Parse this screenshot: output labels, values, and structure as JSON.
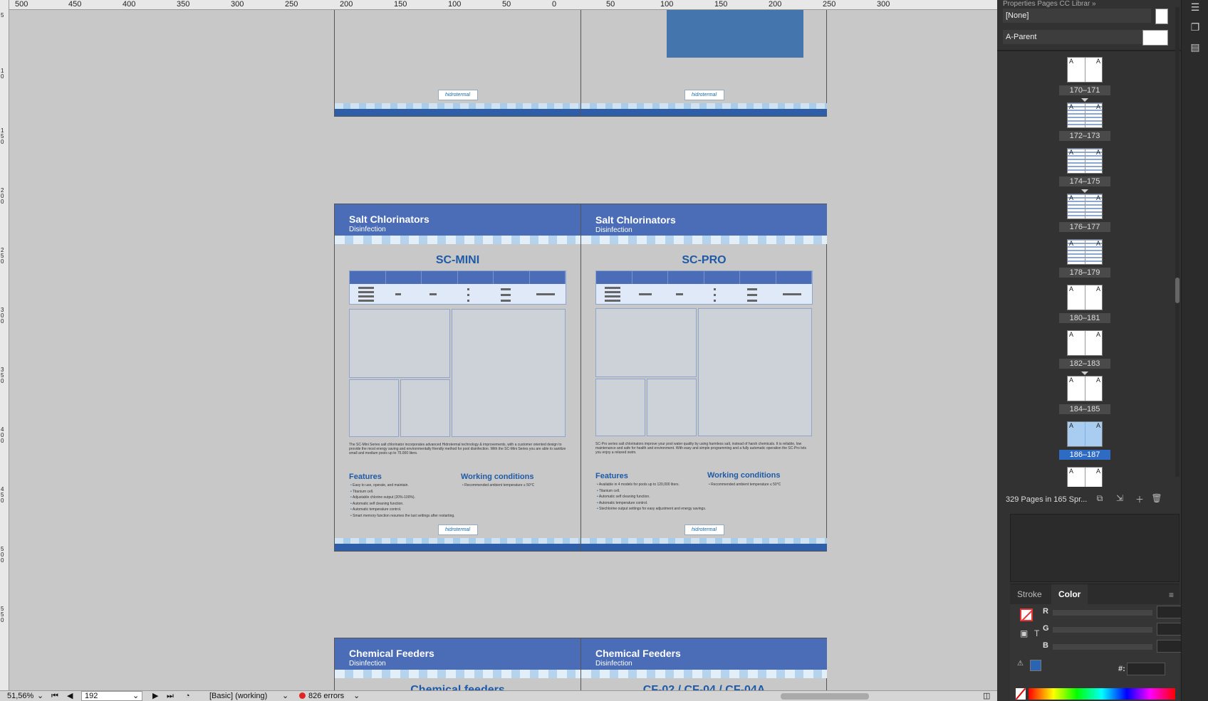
{
  "ruler": {
    "top_labels": [
      "500",
      "450",
      "400",
      "350",
      "300",
      "250",
      "200",
      "150",
      "100",
      "50",
      "0",
      "50",
      "100",
      "150",
      "200",
      "250",
      "300"
    ],
    "left_labels": [
      "5",
      "1 0",
      "1 5 0",
      "2 0 0",
      "2 5 0",
      "3 0 0",
      "3 5 0",
      "4 0 0",
      "4 5 0",
      "5 0 0",
      "5 5 0"
    ]
  },
  "spreads": {
    "mid": {
      "left": {
        "banner_title": "Salt Chlorinators",
        "banner_sub": "Disinfection",
        "product": "SC-MINI",
        "description": "The SC-Mini Series salt chlorinator incorporates advanced Hidrotermal technology & improvements, with a customer oriented design to provide the most energy saving and environmentally friendly method for pool disinfection. With the SC-Mini Series you are able to sanitize small and medium pools up to 75.000 liters.",
        "features_title": "Features",
        "features": [
          "Easy to use, operate, and maintain.",
          "Titanium cell.",
          "Adjustable chlorine output (20%-100%).",
          "Automatic self cleaning function.",
          "Automatic temperature control.",
          "Smart memory function resumes the last settings after restarting."
        ],
        "working_title": "Working conditions",
        "working": [
          "Recommended ambient temperature ≤ 50°C"
        ]
      },
      "right": {
        "banner_title": "Salt Chlorinators",
        "banner_sub": "Disinfection",
        "product": "SC-PRO",
        "description": "SC-Pro series salt chlorinators improve your pool water quality by using harmless salt, instead of harsh chemicals. It is reliable, low maintenance and safe for health and environment. With easy and simple programming and a fully automatic operation the SC-Pro lets you enjoy a relaxed swim.",
        "features_title": "Features",
        "features": [
          "Available in 4 models for pools up to 120,000 liters.",
          "Titanium cell.",
          "Automatic self cleaning function.",
          "Automatic temperature control.",
          "Stechlorine output settings for easy adjustment and energy savings."
        ],
        "working_title": "Working conditions",
        "working": [
          "Recommended ambient temperature ≤ 50°C"
        ]
      }
    },
    "bottom": {
      "left": {
        "banner_title": "Chemical Feeders",
        "banner_sub": "Disinfection",
        "product": "Chemical feeders"
      },
      "right": {
        "banner_title": "Chemical Feeders",
        "banner_sub": "Disinfection",
        "product": "CF-02 / CF-04 / CF-04A"
      }
    },
    "logo_text": "hidrotermal"
  },
  "panel": {
    "tabs_top": "Properties   Pages   CC Librar   »",
    "parent_none": "[None]",
    "parent_a": "A-Parent",
    "pages": [
      {
        "label": "170–171",
        "kind": "blank"
      },
      {
        "label": "172–173",
        "kind": "busy"
      },
      {
        "label": "174–175",
        "kind": "busy"
      },
      {
        "label": "176–177",
        "kind": "busy"
      },
      {
        "label": "178–179",
        "kind": "busy"
      },
      {
        "label": "180–181",
        "kind": "blank"
      },
      {
        "label": "182–183",
        "kind": "blank"
      },
      {
        "label": "184–185",
        "kind": "blank"
      },
      {
        "label": "186–187",
        "kind": "selected"
      },
      {
        "label": "",
        "kind": "blank"
      }
    ],
    "page_master_letter": "A",
    "footer_text": "329 Pages in 165 Spr...",
    "color": {
      "tab_stroke": "Stroke",
      "tab_color": "Color",
      "r_label": "R",
      "g_label": "G",
      "b_label": "B",
      "hex_label": "#:"
    }
  },
  "status": {
    "zoom": "51,56%",
    "page": "192",
    "preflight_profile": "[Basic] (working)",
    "errors": "826 errors"
  },
  "colors": {
    "accent_blue": "#4b6cb7",
    "title_blue": "#1f5aa8",
    "error_red": "#e02424",
    "selection_blue": "#2d6bc4"
  }
}
